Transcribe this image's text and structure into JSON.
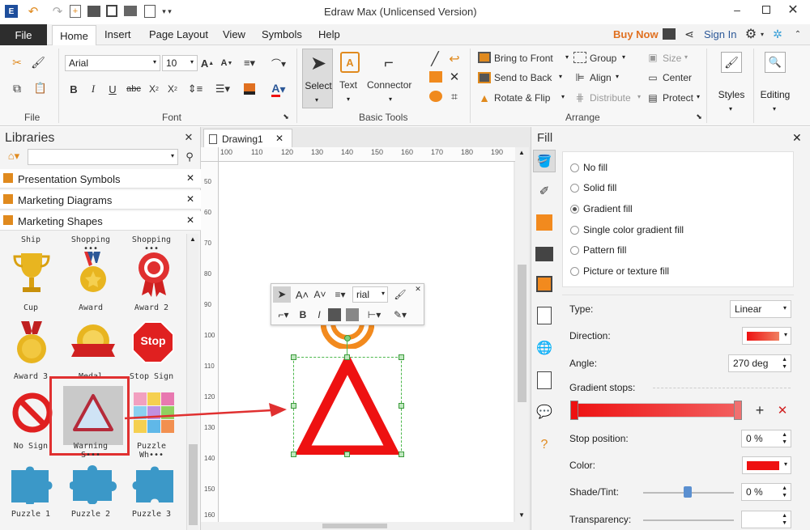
{
  "app": {
    "title": "Edraw Max (Unlicensed Version)",
    "buy_now": "Buy Now",
    "sign_in": "Sign In"
  },
  "menu": {
    "file": "File",
    "home": "Home",
    "insert": "Insert",
    "page_layout": "Page Layout",
    "view": "View",
    "symbols": "Symbols",
    "help": "Help"
  },
  "ribbon": {
    "font_name": "Arial",
    "font_size": "10",
    "groups": {
      "file": "File",
      "font": "Font",
      "basic_tools": "Basic Tools",
      "arrange": "Arrange"
    },
    "tools": {
      "select": "Select",
      "text": "Text",
      "connector": "Connector"
    },
    "arrange": {
      "bring_front": "Bring to Front",
      "send_back": "Send to Back",
      "rotate_flip": "Rotate & Flip",
      "group": "Group",
      "align": "Align",
      "distribute": "Distribute",
      "size": "Size",
      "center": "Center",
      "protect": "Protect"
    },
    "styles": "Styles",
    "editing": "Editing"
  },
  "libraries": {
    "title": "Libraries",
    "sections": [
      "Presentation Symbols",
      "Marketing Diagrams",
      "Marketing Shapes"
    ],
    "captions_row0": [
      "Ship",
      "Shopping •••",
      "Shopping •••"
    ],
    "captions_row1": [
      "Cup",
      "Award",
      "Award 2"
    ],
    "captions_row2": [
      "Award 3",
      "Medal",
      "Stop Sign"
    ],
    "captions_row3": [
      "No Sign",
      "Warning S•••",
      "Puzzle Wh•••"
    ],
    "captions_row4": [
      "Puzzle 1",
      "Puzzle 2",
      "Puzzle 3"
    ],
    "stop_text": "Stop"
  },
  "document": {
    "tab": "Drawing1",
    "ruler_h": [
      "100",
      "110",
      "120",
      "130",
      "140",
      "150",
      "160",
      "170",
      "180",
      "190"
    ],
    "ruler_v": [
      "50",
      "60",
      "70",
      "80",
      "90",
      "100",
      "110",
      "120",
      "130",
      "140",
      "150",
      "160"
    ]
  },
  "minitoolbar": {
    "font": "rial"
  },
  "fill": {
    "title": "Fill",
    "options": [
      "No fill",
      "Solid fill",
      "Gradient fill",
      "Single color gradient fill",
      "Pattern fill",
      "Picture or texture fill"
    ],
    "type_label": "Type:",
    "type_value": "Linear",
    "direction_label": "Direction:",
    "angle_label": "Angle:",
    "angle_value": "270 deg",
    "stops_label": "Gradient stops:",
    "stop_pos_label": "Stop position:",
    "stop_pos_value": "0 %",
    "color_label": "Color:",
    "shade_label": "Shade/Tint:",
    "shade_value": "0 %",
    "transparency_label": "Transparency:"
  },
  "colors": {
    "accent": "#2b5797",
    "red": "#ee1111",
    "buy": "#e07020"
  }
}
